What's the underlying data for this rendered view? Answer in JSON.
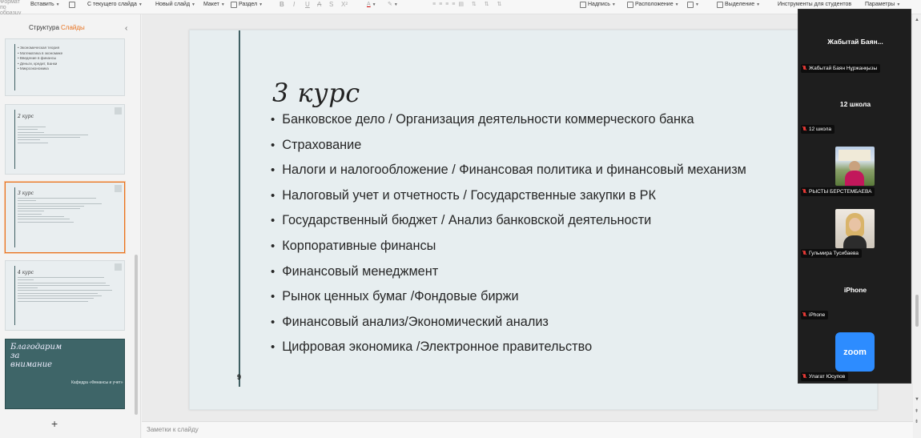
{
  "ribbon": {
    "format_painter": "Формат по образцу",
    "paste": "Вставить",
    "from_current": "С текущего слайда",
    "new_slide": "Новый слайд",
    "layout": "Макет",
    "section": "Раздел",
    "text_box": "Надпись",
    "arrange": "Расположение",
    "selection": "Выделение",
    "student_tools": "Инструменты для студентов",
    "parameters": "Параметры",
    "font_bold": "B",
    "font_italic": "I",
    "font_underline": "U",
    "font_strike": "A",
    "font_s": "S",
    "font_super": "X²"
  },
  "left_panel": {
    "tab_structure": "Структура",
    "tab_slides": "Слайды",
    "collapse": "‹",
    "add_slide": "+",
    "thumb1_lines": [
      "• Экономическая теория",
      "• Математика в экономике",
      "• Введение в финансы",
      "• Деньги, кредит, Банки",
      "• Микроэкономика"
    ],
    "thumb2_title": "2 курс",
    "thumb3_title": "3 курс",
    "thumb4_title": "4 курс",
    "thumb5_title": "Благодарим\nза\nвнимание",
    "thumb5_sub": "Кафедра «Финансы и учет»"
  },
  "slide": {
    "title": "3 курс",
    "bullets": [
      "Банковское дело / Организация деятельности коммерческого банка",
      "Страхование",
      "Налоги и налогообложение / Финансовая политика и финансовый механизм",
      "Налоговый учет и отчетность / Государственные закупки в РК",
      "Государственный бюджет  / Анализ банковской деятельности",
      "Корпоративные финансы",
      "Финансовый менеджмент",
      "Рынок ценных бумаг /Фондовые биржи",
      "Финансовый анализ/Экономический анализ",
      "Цифровая экономика /Электронное правительство"
    ],
    "number": "9"
  },
  "notes": {
    "placeholder": "Заметки к слайду"
  },
  "zoom": {
    "p1_name": "Жабытай Баян...",
    "p1_tag": "Жабытай Баян Нұржанқызы",
    "p2_name": "12 школа",
    "p2_tag": "12 школа",
    "p3_tag": "РЫСТЫ БЕРСТЕМБАЕВА",
    "p4_tag": "Гульмира Тусибаева",
    "p5_name": "iPhone",
    "p5_tag": "iPhone",
    "p6_logo": "zoom",
    "p6_tag": "Улагат Юсупов"
  }
}
